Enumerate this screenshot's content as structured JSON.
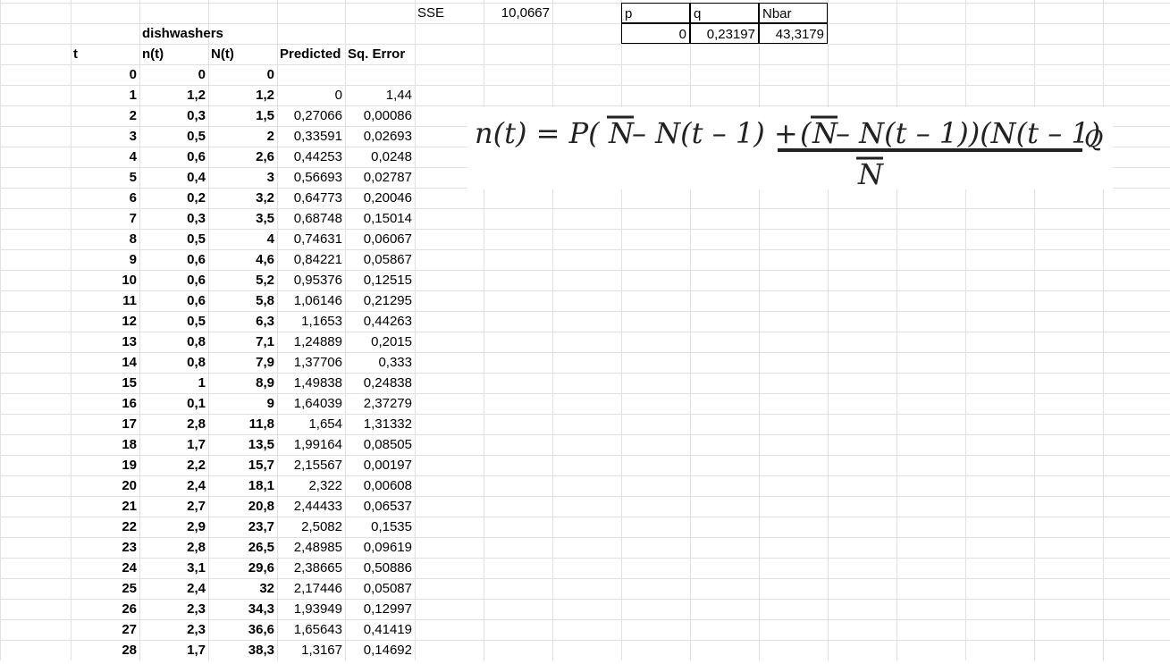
{
  "sheet": {
    "sse": {
      "label": "SSE",
      "value": "10,0667"
    },
    "params": {
      "headers": [
        "p",
        "q",
        "Nbar"
      ],
      "values": [
        "0",
        "0,23197",
        "43,3179"
      ]
    },
    "title": "dishwashers",
    "headers": {
      "t": "t",
      "n": "n(t)",
      "N": "N(t)",
      "pred": "Predicted",
      "err": "Sq. Error"
    },
    "rows": [
      [
        "0",
        "0",
        "0",
        "",
        ""
      ],
      [
        "1",
        "1,2",
        "1,2",
        "0",
        "1,44"
      ],
      [
        "2",
        "0,3",
        "1,5",
        "0,27066",
        "0,00086"
      ],
      [
        "3",
        "0,5",
        "2",
        "0,33591",
        "0,02693"
      ],
      [
        "4",
        "0,6",
        "2,6",
        "0,44253",
        "0,0248"
      ],
      [
        "5",
        "0,4",
        "3",
        "0,56693",
        "0,02787"
      ],
      [
        "6",
        "0,2",
        "3,2",
        "0,64773",
        "0,20046"
      ],
      [
        "7",
        "0,3",
        "3,5",
        "0,68748",
        "0,15014"
      ],
      [
        "8",
        "0,5",
        "4",
        "0,74631",
        "0,06067"
      ],
      [
        "9",
        "0,6",
        "4,6",
        "0,84221",
        "0,05867"
      ],
      [
        "10",
        "0,6",
        "5,2",
        "0,95376",
        "0,12515"
      ],
      [
        "11",
        "0,6",
        "5,8",
        "1,06146",
        "0,21295"
      ],
      [
        "12",
        "0,5",
        "6,3",
        "1,1653",
        "0,44263"
      ],
      [
        "13",
        "0,8",
        "7,1",
        "1,24889",
        "0,2015"
      ],
      [
        "14",
        "0,8",
        "7,9",
        "1,37706",
        "0,333"
      ],
      [
        "15",
        "1",
        "8,9",
        "1,49838",
        "0,24838"
      ],
      [
        "16",
        "0,1",
        "9",
        "1,64039",
        "2,37279"
      ],
      [
        "17",
        "2,8",
        "11,8",
        "1,654",
        "1,31332"
      ],
      [
        "18",
        "1,7",
        "13,5",
        "1,99164",
        "0,08505"
      ],
      [
        "19",
        "2,2",
        "15,7",
        "2,15567",
        "0,00197"
      ],
      [
        "20",
        "2,4",
        "18,1",
        "2,322",
        "0,00608"
      ],
      [
        "21",
        "2,7",
        "20,8",
        "2,44433",
        "0,06537"
      ],
      [
        "22",
        "2,9",
        "23,7",
        "2,5082",
        "0,1535"
      ],
      [
        "23",
        "2,8",
        "26,5",
        "2,48985",
        "0,09619"
      ],
      [
        "24",
        "3,1",
        "29,6",
        "2,38665",
        "0,50886"
      ],
      [
        "25",
        "2,4",
        "32",
        "2,17446",
        "0,05087"
      ],
      [
        "26",
        "2,3",
        "34,3",
        "1,93949",
        "0,12997"
      ],
      [
        "27",
        "2,3",
        "36,6",
        "1,65643",
        "0,41419"
      ],
      [
        "28",
        "1,7",
        "38,3",
        "1,3167",
        "0,14692"
      ]
    ]
  },
  "formula": {
    "lhs": "n(t) = P(",
    "nbar1": "N",
    "mid1": " – N(t – 1) + ",
    "numerator_open": "(",
    "nbar2": "N",
    "numerator_rest": " – N(t – 1))(N(t – 1)",
    "q": "Q",
    "denominator": "N"
  }
}
